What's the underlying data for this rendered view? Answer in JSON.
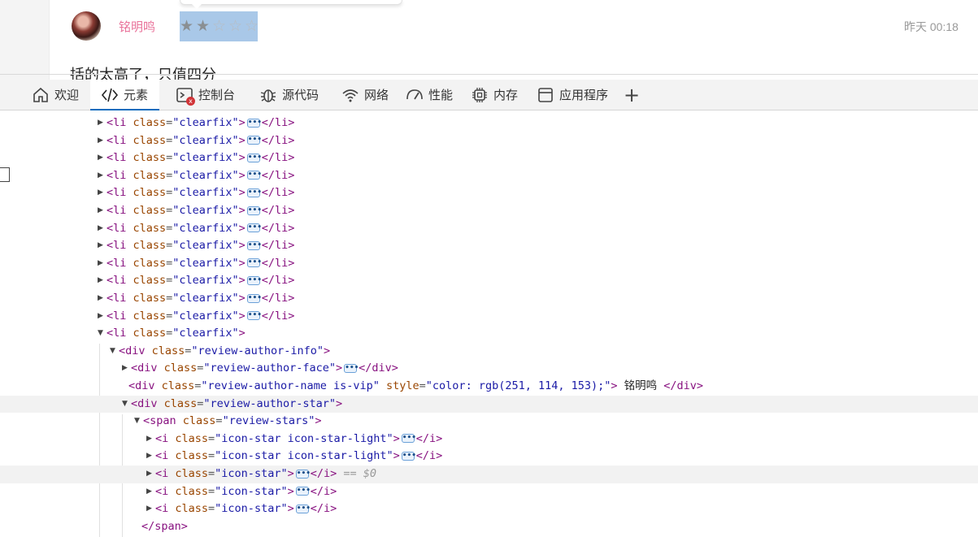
{
  "webpage": {
    "author_name": "铭明鸣",
    "timestamp": "昨天 00:18",
    "review_text": "括的太高了，只值四分",
    "stars": [
      {
        "state": "light",
        "glyph": "★"
      },
      {
        "state": "light",
        "glyph": "★"
      },
      {
        "state": "dim",
        "glyph": "☆"
      },
      {
        "state": "dim",
        "glyph": "☆"
      },
      {
        "state": "dim",
        "glyph": "☆"
      }
    ],
    "rating": 2,
    "rating_max": 5
  },
  "devtools": {
    "tabs": [
      {
        "name": "welcome",
        "label": "欢迎",
        "icon": "home-icon"
      },
      {
        "name": "elements",
        "label": "元素",
        "icon": "code-icon",
        "active": true
      },
      {
        "name": "console",
        "label": "控制台",
        "icon": "console-icon",
        "badge": "x"
      },
      {
        "name": "sources",
        "label": "源代码",
        "icon": "bug-icon"
      },
      {
        "name": "network",
        "label": "网络",
        "icon": "wifi-icon"
      },
      {
        "name": "performance",
        "label": "性能",
        "icon": "gauge-icon"
      },
      {
        "name": "memory",
        "label": "内存",
        "icon": "chip-icon"
      },
      {
        "name": "application",
        "label": "应用程序",
        "icon": "window-icon"
      }
    ],
    "add_tab_symbol": "+"
  },
  "tree": {
    "li_tag": "li",
    "li_attr": "class",
    "li_val": "clearfix",
    "collapsed_li_count": 12,
    "rows": [
      {
        "open": "<div ",
        "attr": "class",
        "val": "review-author-info",
        "close": ">"
      },
      {
        "open": "<div ",
        "attr": "class",
        "val": "review-author-face",
        "close": ">",
        "collapsed": true,
        "end": "</div>"
      },
      {
        "open": "<div ",
        "attr": "class",
        "val": "review-author-name is-vip",
        "attr2": "style",
        "val2": "color: rgb(251, 114, 153);",
        "close": ">",
        "text": " 铭明鸣 ",
        "end": "</div>"
      },
      {
        "open": "<div ",
        "attr": "class",
        "val": "review-author-star",
        "close": ">"
      },
      {
        "open": "<span ",
        "attr": "class",
        "val": "review-stars",
        "close": ">"
      },
      {
        "open": "<i ",
        "attr": "class",
        "val": "icon-star icon-star-light",
        "close": ">",
        "collapsed": true,
        "end": "</i>"
      },
      {
        "open": "<i ",
        "attr": "class",
        "val": "icon-star icon-star-light",
        "close": ">",
        "collapsed": true,
        "end": "</i>"
      },
      {
        "open": "<i ",
        "attr": "class",
        "val": "icon-star",
        "close": ">",
        "collapsed": true,
        "end": "</i>",
        "selected_marker": " == $0"
      },
      {
        "open": "<i ",
        "attr": "class",
        "val": "icon-star",
        "close": ">",
        "collapsed": true,
        "end": "</i>"
      },
      {
        "open": "<i ",
        "attr": "class",
        "val": "icon-star",
        "close": ">",
        "collapsed": true,
        "end": "</i>"
      },
      {
        "open": "</span>"
      }
    ]
  }
}
